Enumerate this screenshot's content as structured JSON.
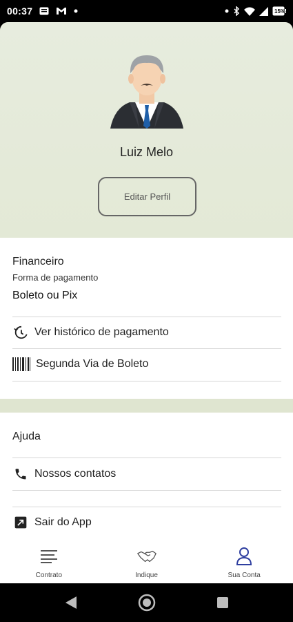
{
  "status_bar": {
    "time": "00:37",
    "battery": "15%",
    "icons": [
      "notification-icon",
      "gmail-icon",
      "dot-icon",
      "dot-icon",
      "bluetooth-icon",
      "wifi-icon",
      "signal-icon",
      "battery-icon"
    ]
  },
  "profile": {
    "name": "Luiz Melo",
    "edit_label": "Editar Perfil",
    "avatar_icon": "businessman-avatar"
  },
  "finance": {
    "title": "Financeiro",
    "payment_label": "Forma de pagamento",
    "payment_value": "Boleto ou Pix",
    "items": [
      {
        "label": "Ver histórico de pagamento",
        "icon": "history-icon"
      },
      {
        "label": "Segunda Via de Boleto",
        "icon": "barcode-icon"
      }
    ]
  },
  "help": {
    "title": "Ajuda",
    "items": [
      {
        "label": "Nossos contatos",
        "icon": "phone-icon"
      },
      {
        "label": "Sair do App",
        "icon": "exit-icon"
      }
    ]
  },
  "bottom_nav": {
    "items": [
      {
        "label": "Contrato",
        "icon": "list-icon"
      },
      {
        "label": "Indique",
        "icon": "handshake-icon"
      },
      {
        "label": "Sua Conta",
        "icon": "user-icon"
      }
    ],
    "active_color": "#2f3fa0"
  },
  "colors": {
    "hero_background": "#e5ead9",
    "accent": "#2f3fa0"
  }
}
